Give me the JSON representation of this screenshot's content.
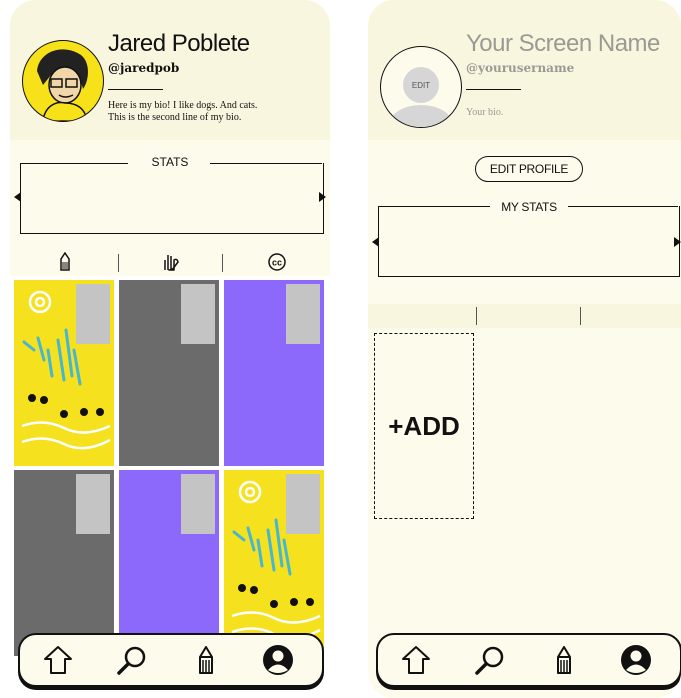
{
  "profile": {
    "name": "Jared Poblete",
    "handle": "@jaredpob",
    "bio_line1": "Here is my bio! I like dogs. And cats.",
    "bio_line2": "This is the second line of my bio.",
    "stats_label": "STATS",
    "tabs": [
      "drawings-icon",
      "gesture-icon",
      "cc-icon"
    ],
    "grid": [
      "yellow-art",
      "gray",
      "purple",
      "gray",
      "purple",
      "yellow-art"
    ]
  },
  "edit": {
    "name_placeholder": "Your Screen Name",
    "handle_placeholder": "@yourusername",
    "bio_placeholder": "Your bio.",
    "avatar_edit": "EDIT",
    "edit_profile_label": "EDIT PROFILE",
    "stats_label": "MY STATS",
    "add_label": "+ADD"
  },
  "nav": [
    "home-icon",
    "search-icon",
    "pen-icon",
    "profile-icon"
  ],
  "colors": {
    "background": "#fdfbec",
    "header": "#f9f6df",
    "purple": "#8c69fb",
    "gray": "#6b6b6b",
    "yellow": "#f5e11d",
    "placeholder": "#c4c4c4"
  }
}
